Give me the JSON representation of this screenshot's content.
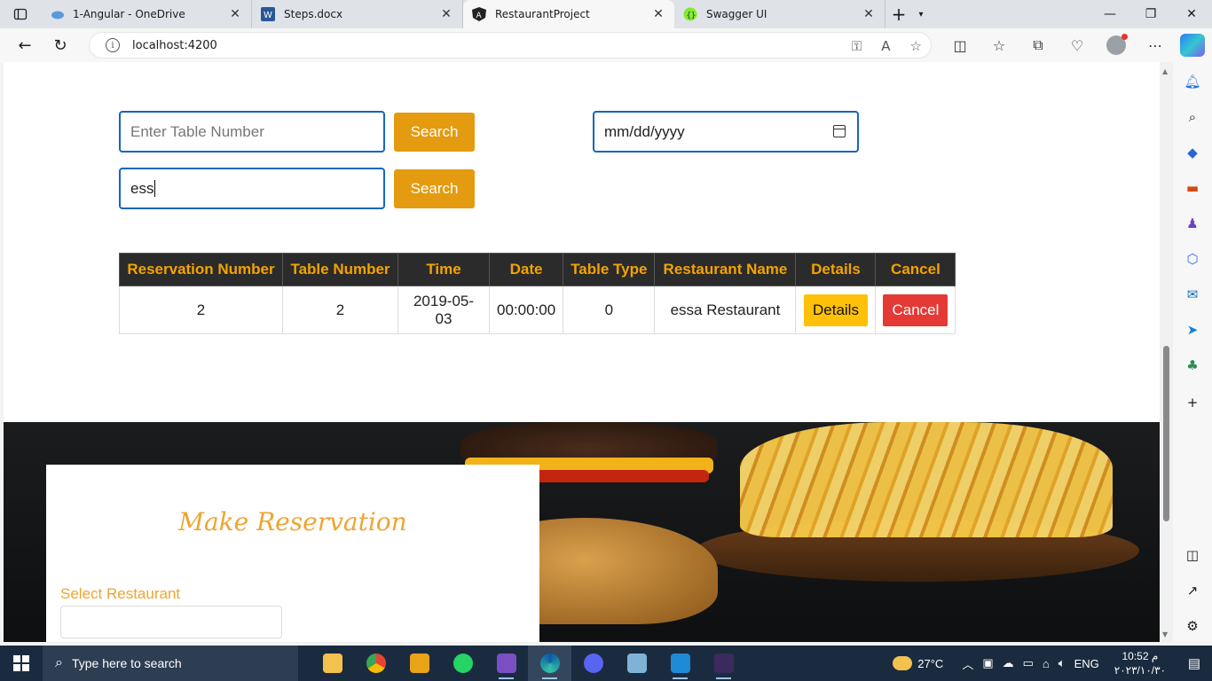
{
  "browser": {
    "tabs": [
      {
        "title": "1-Angular - OneDrive",
        "icon": "onedrive-cloud-icon"
      },
      {
        "title": "Steps.docx",
        "icon": "word-doc-icon"
      },
      {
        "title": "RestaurantProject",
        "icon": "angular-icon",
        "active": true
      },
      {
        "title": "Swagger UI",
        "icon": "swagger-icon"
      }
    ],
    "url": "localhost:4200"
  },
  "search": {
    "table_placeholder": "Enter Table Number",
    "table_value": "",
    "search1_label": "Search",
    "name_value": "ess",
    "search2_label": "Search",
    "date_placeholder": "mm/dd/yyyy"
  },
  "table": {
    "headers": [
      "Reservation Number",
      "Table Number",
      "Time",
      "Date",
      "Table Type",
      "Restaurant Name",
      "Details",
      "Cancel"
    ],
    "rows": [
      {
        "reservation_number": "2",
        "table_number": "2",
        "time": "2019-05-03",
        "date": "00:00:00",
        "table_type": "0",
        "restaurant_name": "essa Restaurant",
        "details_label": "Details",
        "cancel_label": "Cancel"
      }
    ]
  },
  "reservation": {
    "title": "Make Reservation",
    "select_label": "Select Restaurant"
  },
  "taskbar": {
    "search_placeholder": "Type here to search",
    "temperature": "27°C",
    "language": "ENG",
    "time": "10:52 م",
    "date": "٢٠٢٣/١٠/٣٠"
  },
  "colors": {
    "accent": "#e49b0f",
    "header_bg": "#2b2b2b",
    "header_text": "#f4a300",
    "cancel": "#e53935",
    "details": "#ffc107"
  }
}
